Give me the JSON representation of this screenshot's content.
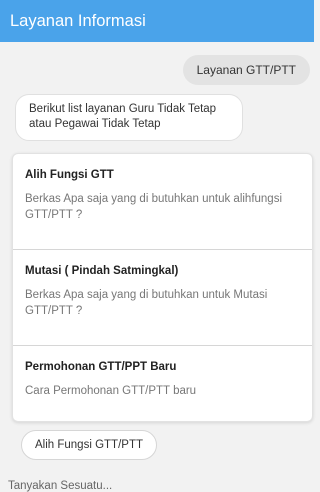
{
  "header": {
    "title": "Layanan Informasi"
  },
  "chat": {
    "user_message": "Layanan GTT/PTT",
    "bot_message": "Berikut list layanan Guru Tidak Tetap atau Pegawai Tidak Tetap"
  },
  "cards": [
    {
      "title": "Alih Fungsi GTT",
      "description": "Berkas Apa saja yang di butuhkan untuk alihfungsi GTT/PTT ?"
    },
    {
      "title": "Mutasi ( Pindah Satmingkal)",
      "description": "Berkas Apa saja yang di butuhkan untuk Mutasi GTT/PTT ?"
    },
    {
      "title": "Permohonan GTT/PPT Baru",
      "description": "Cara Permohonan GTT/PTT baru"
    }
  ],
  "quick_reply": {
    "label": "Alih Fungsi GTT/PTT"
  },
  "input": {
    "placeholder": "Tanyakan Sesuatu..."
  },
  "colors": {
    "header": "#4aa3ea",
    "background": "#f2f2f2"
  }
}
